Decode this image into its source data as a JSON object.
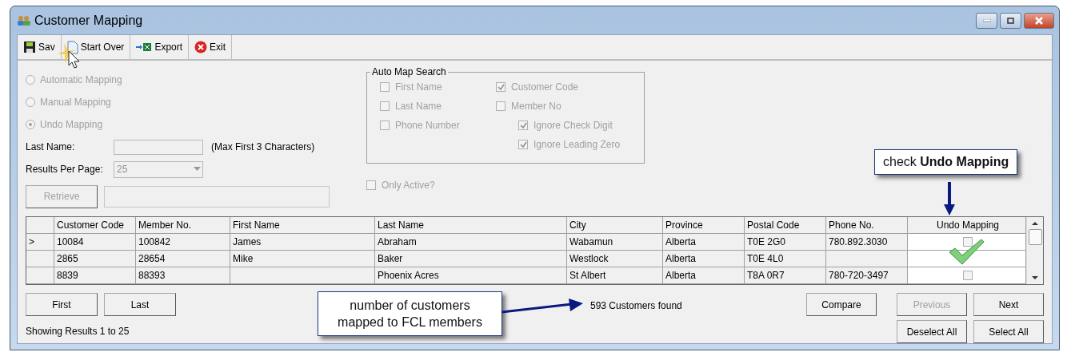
{
  "window": {
    "title": "Customer Mapping"
  },
  "toolbar": [
    {
      "kind": "save",
      "label": "Sav"
    },
    {
      "kind": "new",
      "label": "Start Over"
    },
    {
      "kind": "export",
      "label": "Export"
    },
    {
      "kind": "exit",
      "label": "Exit"
    }
  ],
  "mode_options": [
    {
      "label": "Automatic Mapping",
      "selected": false
    },
    {
      "label": "Manual Mapping",
      "selected": false
    },
    {
      "label": "Undo Mapping",
      "selected": true
    }
  ],
  "last_name": {
    "label": "Last Name:",
    "hint": "(Max First 3 Characters)"
  },
  "results_per_page": {
    "label": "Results Per Page:",
    "value": "25"
  },
  "retrieve_button": "Retrieve",
  "auto_map_search": {
    "title": "Auto Map Search",
    "options": [
      {
        "label": "First Name",
        "checked": false
      },
      {
        "label": "Customer Code",
        "checked": true
      },
      {
        "label": "Last Name",
        "checked": false
      },
      {
        "label": "Member No",
        "checked": false
      },
      {
        "label": "Phone Number",
        "checked": false
      },
      {
        "label": "Ignore Check Digit",
        "checked": true
      },
      {
        "label": "Ignore Leading Zero",
        "checked": true
      }
    ]
  },
  "only_active": {
    "label": "Only Active?",
    "checked": false
  },
  "table": {
    "columns": [
      "Customer Code",
      "Member No.",
      "First Name",
      "Last Name",
      "City",
      "Province",
      "Postal Code",
      "Phone No.",
      "Undo Mapping"
    ],
    "rows": [
      {
        "current": true,
        "cells": [
          "10084",
          "100842",
          "James",
          "Abraham",
          "Wabamun",
          "Alberta",
          "T0E 2G0",
          "780.892.3030"
        ],
        "undo": false
      },
      {
        "current": false,
        "cells": [
          "2865",
          "28654",
          "Mike",
          "Baker",
          "Westlock",
          "Alberta",
          "T0E 4L0",
          ""
        ],
        "undo": true
      },
      {
        "current": false,
        "cells": [
          "8839",
          "88393",
          "",
          "Phoenix Acres",
          "St Albert",
          "Alberta",
          "T8A 0R7",
          "780-720-3497"
        ],
        "undo": false
      }
    ]
  },
  "row_marker": ">",
  "nav_buttons": [
    {
      "label": "First",
      "disabled": false
    },
    {
      "label": "Last",
      "disabled": false
    }
  ],
  "status": "593 Customers found",
  "showing": "Showing Results 1 to 25",
  "right_buttons": [
    {
      "label": "Compare",
      "disabled": false
    },
    {
      "label": "Previous",
      "disabled": true
    },
    {
      "label": "Next",
      "disabled": false
    }
  ],
  "select_buttons": [
    {
      "label": "Deselect All",
      "disabled": false
    },
    {
      "label": "Select All",
      "disabled": false
    }
  ],
  "callouts": [
    {
      "kind": "undo",
      "text": "check **Undo Mapping**"
    },
    {
      "kind": "count",
      "text": "number of customers mapped to FCL members"
    }
  ]
}
